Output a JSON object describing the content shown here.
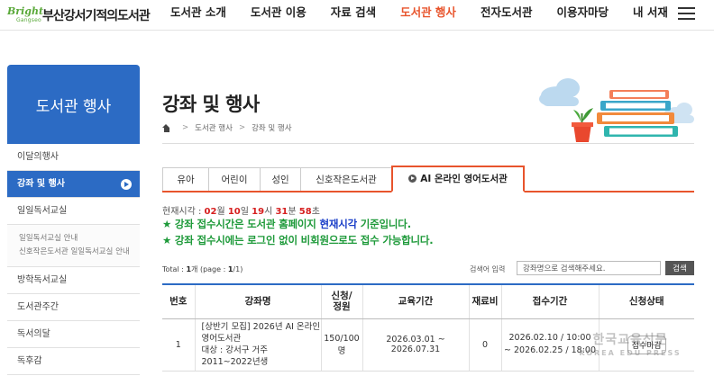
{
  "site": {
    "logo_bright": "Bright",
    "logo_gangseo": "Gangseo",
    "logo_name": "부산강서기적의도서관"
  },
  "gnb": [
    {
      "label": "도서관 소개"
    },
    {
      "label": "도서관 이용"
    },
    {
      "label": "자료 검색"
    },
    {
      "label": "도서관 행사",
      "active": true
    },
    {
      "label": "전자도서관"
    },
    {
      "label": "이용자마당"
    },
    {
      "label": "내 서재"
    }
  ],
  "sidebar": {
    "title": "도서관 행사",
    "items": [
      {
        "label": "이달의행사"
      },
      {
        "label": "강좌 및 행사",
        "active": true
      },
      {
        "label": "일일독서교실"
      },
      {
        "label": "방학독서교실"
      },
      {
        "label": "도서관주간"
      },
      {
        "label": "독서의달"
      },
      {
        "label": "독후감"
      }
    ],
    "sub_items": [
      {
        "label": "일일독서교실 안내"
      },
      {
        "label": "신호작은도서관 일일독서교실 안내"
      }
    ]
  },
  "page": {
    "title": "강좌 및 행사",
    "breadcrumb": [
      "도서관 행사",
      "강좌 및 행사"
    ]
  },
  "tabs": [
    {
      "label": "유아",
      "w": 52
    },
    {
      "label": "어린이",
      "w": 58
    },
    {
      "label": "성인",
      "w": 46
    },
    {
      "label": "신호작은도서관",
      "w": 102
    },
    {
      "label": "AI 온라인 영어도서관",
      "w": 146,
      "active": true
    }
  ],
  "clock": {
    "prefix": "현재시각 : ",
    "month": "02",
    "month_unit": "월 ",
    "day": "10",
    "day_unit": "일 ",
    "hour": "19",
    "hour_unit": "시 ",
    "minute": "31",
    "minute_unit": "분 ",
    "second": "58",
    "second_unit": "초"
  },
  "notices": {
    "n1_a": "★ 강좌 접수시간은 도서관 홈페이지 ",
    "n1_b": "현재시각",
    "n1_c": " 기준입니다.",
    "n2": "★ 강좌 접수시에는 로그인 없이 비회원으로도 접수 가능합니다."
  },
  "list": {
    "total_prefix": "Total : ",
    "total_count": "1",
    "total_mid": "개 (page : ",
    "page_current": "1",
    "page_sep": "/",
    "page_total": "1",
    "total_suffix": ")",
    "search_label": "검색어 입력",
    "search_value": "강좌명으로 검색해주세요.",
    "search_button": "검색"
  },
  "table": {
    "headers": {
      "no": "번호",
      "name": "강좌명",
      "apply_1": "신청/",
      "apply_2": "정원",
      "period": "교육기간",
      "fee": "재료비",
      "reception": "접수기간",
      "status": "신청상태"
    },
    "rows": [
      {
        "no": "1",
        "name_1": "[상반기 모집] 2026년 AI 온라인",
        "name_2": "영어도서관",
        "name_3": "대상 : 강서구 거주 2011~2022년생",
        "apply_1": "150/100",
        "apply_2": "명",
        "period": "2026.03.01 ~ 2026.07.31",
        "fee": "0",
        "reception_1": "2026.02.10 / 10:00",
        "reception_2": "~ 2026.02.25 / 18:00",
        "status": "접수마감"
      }
    ]
  },
  "watermark": {
    "line1": "한국교육신문",
    "line2": "KOREA EDU PRESS"
  },
  "colors": {
    "accent": "#e8542c",
    "primary": "#2c6bc4",
    "notice_green": "#1e9a3a",
    "notice_blue": "#1a3ec8",
    "time_red": "#d62020"
  }
}
